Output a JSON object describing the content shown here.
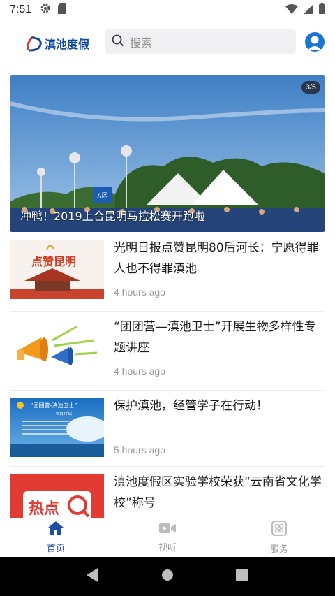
{
  "status_bar": {
    "time": "7:51"
  },
  "header": {
    "logo_text": "滇池度假",
    "search_placeholder": "搜索"
  },
  "banner": {
    "caption": "冲鸭！2019上合昆明马拉松赛开跑啦",
    "counter": "3/5",
    "sign_text": "A区"
  },
  "news": [
    {
      "title": "光明日报点赞昆明80后河长：宁愿得罪人也不得罪滇池",
      "time": "4 hours ago",
      "thumb_text": "点赞昆明"
    },
    {
      "title": "“团团营—滇池卫士”开展生物多样性专题讲座",
      "time": "4 hours ago"
    },
    {
      "title": "保护滇池，经管学子在行动！",
      "time": "5 hours ago",
      "thumb_text": "“团团营-滇池卫士”",
      "thumb_sub": "项目介绍"
    },
    {
      "title": "滇池度假区实验学校荣获“云南省文化学校”称号",
      "time": "",
      "thumb_text": "热点"
    }
  ],
  "bottom_nav": [
    {
      "label": "首页",
      "icon": "home-icon",
      "active": true
    },
    {
      "label": "视听",
      "icon": "video-icon",
      "active": false
    },
    {
      "label": "服务",
      "icon": "service-icon",
      "active": false
    }
  ],
  "colors": {
    "accent": "#1e4fa3",
    "brand": "#0e4a9e"
  }
}
